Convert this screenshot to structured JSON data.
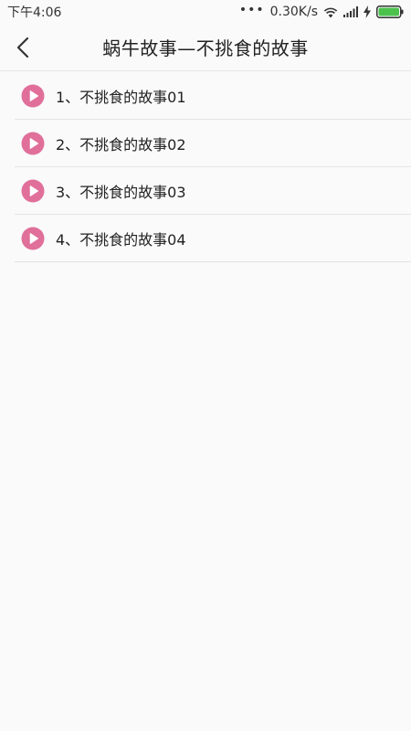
{
  "status_bar": {
    "time": "下午4:06",
    "network_speed": "0.30K/s",
    "dots": "•••",
    "icons": [
      "wifi-icon",
      "signal-icon",
      "charging-icon",
      "battery-icon"
    ]
  },
  "header": {
    "title": "蜗牛故事—不挑食的故事",
    "back_icon": "chevron-left-icon"
  },
  "stories": [
    {
      "title": "1、不挑食的故事01"
    },
    {
      "title": "2、不挑食的故事02"
    },
    {
      "title": "3、不挑食的故事03"
    },
    {
      "title": "4、不挑食的故事04"
    }
  ],
  "colors": {
    "play_icon": "#e06f9a",
    "battery": "#4cc24c"
  }
}
